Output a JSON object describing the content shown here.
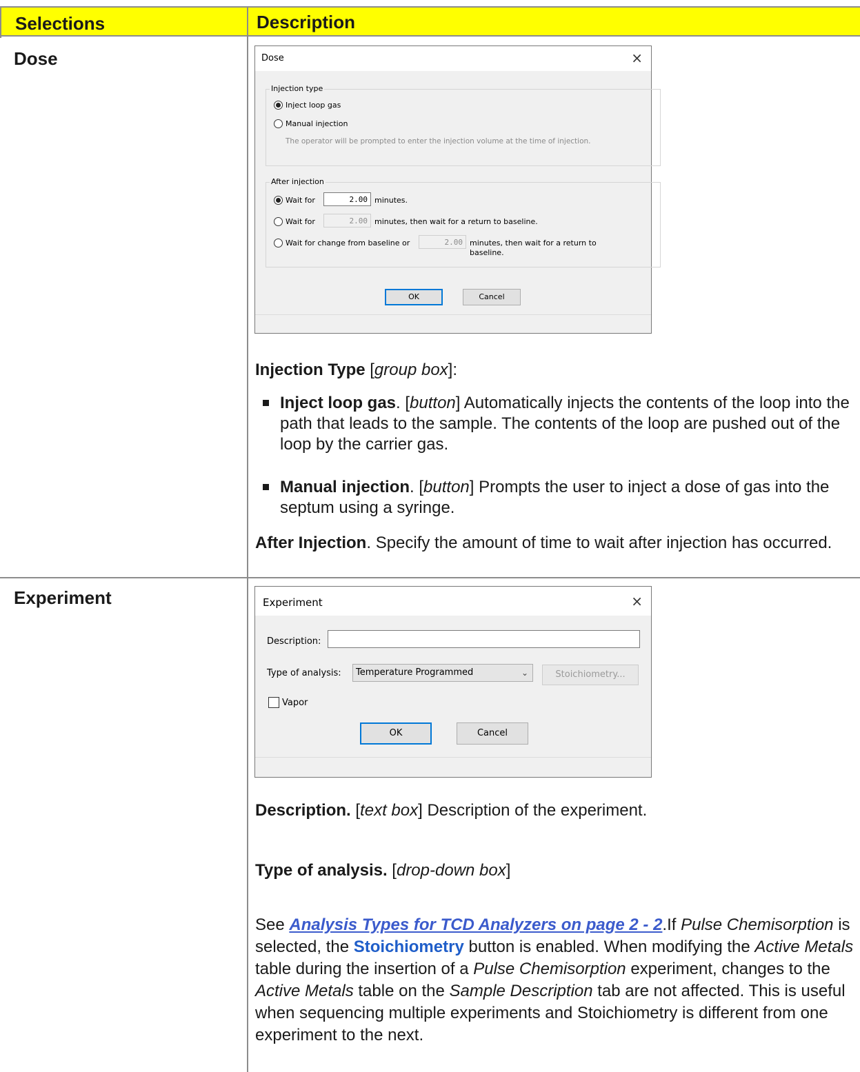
{
  "table": {
    "headers": {
      "selections": "Selections",
      "description": "Description"
    },
    "header_color": "#ffff00"
  },
  "rows": {
    "dose": {
      "selection": "Dose",
      "dialog": {
        "title": "Dose",
        "close_glyph": "×",
        "injection_group": "Injection type",
        "inject_loop": "Inject loop gas",
        "manual_injection": "Manual injection",
        "hint": "The operator will be prompted to enter the injection volume at the time of injection.",
        "after_group": "After injection",
        "wait_for_1": "Wait for",
        "value_1": "2.00",
        "suffix_1": "minutes.",
        "wait_for_2": "Wait for",
        "value_2": "2.00",
        "suffix_2": "minutes, then wait for a return to baseline.",
        "wait_for_3": "Wait for change from baseline or",
        "value_3": "2.00",
        "suffix_3a": "minutes, then wait for a return to",
        "suffix_3b": "baseline.",
        "ok": "OK",
        "cancel": "Cancel"
      },
      "injection_type": {
        "title": "Injection Type",
        "note": "group box"
      },
      "bullets": [
        {
          "term": "Inject loop gas",
          "kind": "button",
          "text": "Automatically injects the contents of the loop into the path that leads to the sample. The contents of the loop are pushed out of the loop by the carrier gas."
        },
        {
          "term": "Manual injection",
          "kind": "button",
          "text": "Prompts the user to inject a dose of gas into the septum using a syringe."
        }
      ],
      "after_injection": {
        "term": "After Injection",
        "text": "Specify the amount of time to wait after injection has occurred."
      }
    },
    "experiment": {
      "selection": "Experiment",
      "dialog": {
        "title": "Experiment",
        "close_glyph": "×",
        "description_label": "Description:",
        "description_value": "",
        "type_label": "Type of analysis:",
        "type_value": "Temperature Programmed",
        "stoich_button": "Stoichiometry...",
        "vapor": "Vapor",
        "ok": "OK",
        "cancel": "Cancel"
      },
      "description": {
        "term": "Description.",
        "kind": "text box",
        "text": "Description of the experiment."
      },
      "type_of_analysis": {
        "term": "Type of analysis.",
        "kind": "drop-down box"
      },
      "see": {
        "prefix": "See ",
        "link": "Analysis Types for TCD Analyzers on page 2 - 2",
        "after_link": ".If ",
        "pulse": "Pulse Chemisorption",
        "is_selected": " is selected, the ",
        "stoich": "Stoichiometry",
        "enabled": " button is enabled. When modifying the ",
        "active_metals": "Active Metals",
        "during": " table during the insertion of a ",
        "pulse2": "Pulse Chemisorption",
        "changes": " experiment, changes to the ",
        "active_metals2": "Active Metals",
        "table_on": " table on the ",
        "sample_desc": "Sample Description",
        "rest": " tab are not affected. This is useful when sequencing multiple experiments and Stoichiometry is different from one experiment to the next."
      }
    }
  }
}
